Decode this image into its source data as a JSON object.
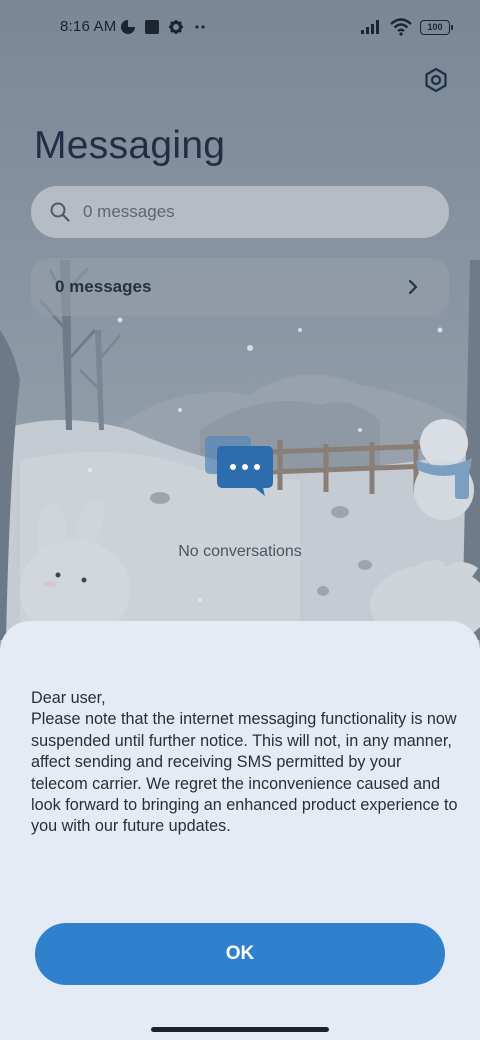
{
  "status_bar": {
    "time": "8:16 AM",
    "left_icons": [
      "data-saver-icon",
      "app-notification-icon",
      "settings-gear-icon",
      "more-dots-icon"
    ],
    "right_icons": [
      "signal-icon",
      "wifi-icon",
      "battery-icon"
    ],
    "battery_level": "100"
  },
  "header": {
    "title": "Messaging",
    "settings_icon": "settings-icon"
  },
  "search": {
    "placeholder": "0 messages",
    "icon": "search-icon"
  },
  "messages_row": {
    "label": "0 messages",
    "icon": "chevron-right-icon"
  },
  "empty_state": {
    "icon": "chat-bubble-icon",
    "text": "No conversations"
  },
  "dialog": {
    "message": "Dear user,\nPlease note that the internet messaging functionality is now suspended until further notice. This will not, in any manner, affect sending and receiving SMS permitted by your telecom carrier. We regret the inconvenience caused and look forward to bringing an enhanced product experience to you with our future updates.",
    "ok_label": "OK"
  },
  "colors": {
    "accent": "#3081CD",
    "sheet_background": "#E4EBF5",
    "title_text": "#1F2F45"
  }
}
